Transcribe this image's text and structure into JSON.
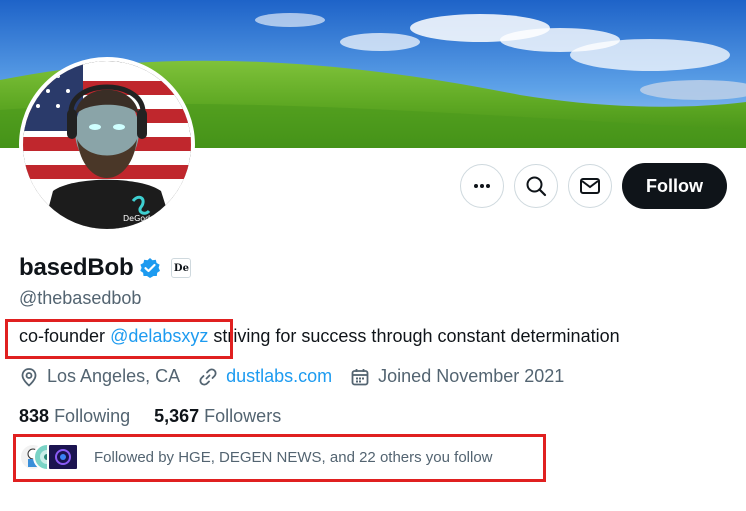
{
  "profile": {
    "display_name": "basedBob",
    "affiliate_badge": "De",
    "handle": "@thebasedbob",
    "bio": {
      "prefix": "co-founder ",
      "mention": "@delabsxyz",
      "suffix": " striving for success through constant determination"
    },
    "location": "Los Angeles, CA",
    "website": "dustlabs.com",
    "joined": "Joined November 2021",
    "following_count": "838",
    "following_label": "Following",
    "followers_count": "5,367",
    "followers_label": "Followers",
    "followed_by": "Followed by HGE, DEGEN NEWS, and 22 others you follow"
  },
  "actions": {
    "follow_label": "Follow",
    "more_icon": "more-icon",
    "search_icon": "search-icon",
    "message_icon": "mail-icon"
  },
  "colors": {
    "link": "#1d9bf0",
    "verified": "#1d9bf0",
    "highlight": "#e02020",
    "follow_button": "#0f1419"
  }
}
